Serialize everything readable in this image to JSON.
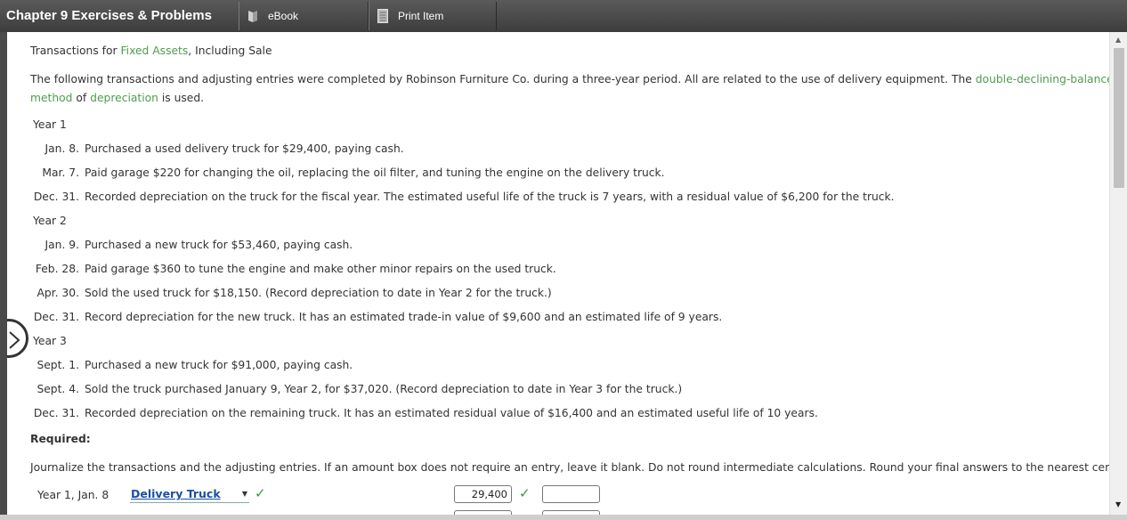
{
  "app": {
    "title": "Chapter 9 Exercises & Problems",
    "tabs": [
      {
        "label": "eBook",
        "icon": "ebook-icon"
      },
      {
        "label": "Print Item",
        "icon": "print-icon"
      }
    ]
  },
  "problem": {
    "title_pre": "Transactions for ",
    "title_link": "Fixed Assets",
    "title_post": ", Including Sale",
    "intro_1": "The following transactions and adjusting entries were completed by Robinson Furniture Co. during a three-year period. All are related to the use of delivery equipment. The ",
    "intro_link_1": "double-declining-balance",
    "intro_link_2": "method",
    "intro_2": " of ",
    "intro_link_3": "depreciation",
    "intro_3": " is used.",
    "years": [
      {
        "label": "Year 1",
        "entries": [
          {
            "date": "Jan. 8.",
            "text": "Purchased a used delivery truck for $29,400, paying cash."
          },
          {
            "date": "Mar. 7.",
            "text": "Paid garage $220 for changing the oil, replacing the oil filter, and tuning the engine on the delivery truck."
          },
          {
            "date": "Dec. 31.",
            "text": "Recorded depreciation on the truck for the fiscal year. The estimated useful life of the truck is 7 years, with a residual value of $6,200 for the truck."
          }
        ]
      },
      {
        "label": "Year 2",
        "entries": [
          {
            "date": "Jan. 9.",
            "text": "Purchased a new truck for $53,460, paying cash."
          },
          {
            "date": "Feb. 28.",
            "text": "Paid garage $360 to tune the engine and make other minor repairs on the used truck."
          },
          {
            "date": "Apr. 30.",
            "text": "Sold the used truck for $18,150. (Record depreciation to date in Year 2 for the truck.)"
          },
          {
            "date": "Dec. 31.",
            "text": "Record depreciation for the new truck. It has an estimated trade-in value of $9,600 and an estimated life of 9 years."
          }
        ]
      },
      {
        "label": "Year 3",
        "entries": [
          {
            "date": "Sept. 1.",
            "text": "Purchased a new truck for $91,000, paying cash."
          },
          {
            "date": "Sept. 4.",
            "text": "Sold the truck purchased January 9, Year 2, for $37,020. (Record depreciation to date in Year 3 for the truck.)"
          },
          {
            "date": "Dec. 31.",
            "text": "Recorded depreciation on the remaining truck. It has an estimated residual value of $16,400 and an estimated useful life of 10 years."
          }
        ]
      }
    ],
    "required_label": "Required:",
    "instructions": "Journalize the transactions and the adjusting entries. If an amount box does not require an entry, leave it blank. Do not round intermediate calculations. Round your final answers to the nearest cent."
  },
  "journal": {
    "row1": {
      "date": "Year 1, Jan. 8",
      "account": "Delivery Truck",
      "debit": "29,400",
      "credit": ""
    }
  },
  "colors": {
    "link": "#4f9c4f",
    "account_link": "#1a4fa3",
    "check": "#2e9d2e",
    "topbar": "#444444"
  }
}
